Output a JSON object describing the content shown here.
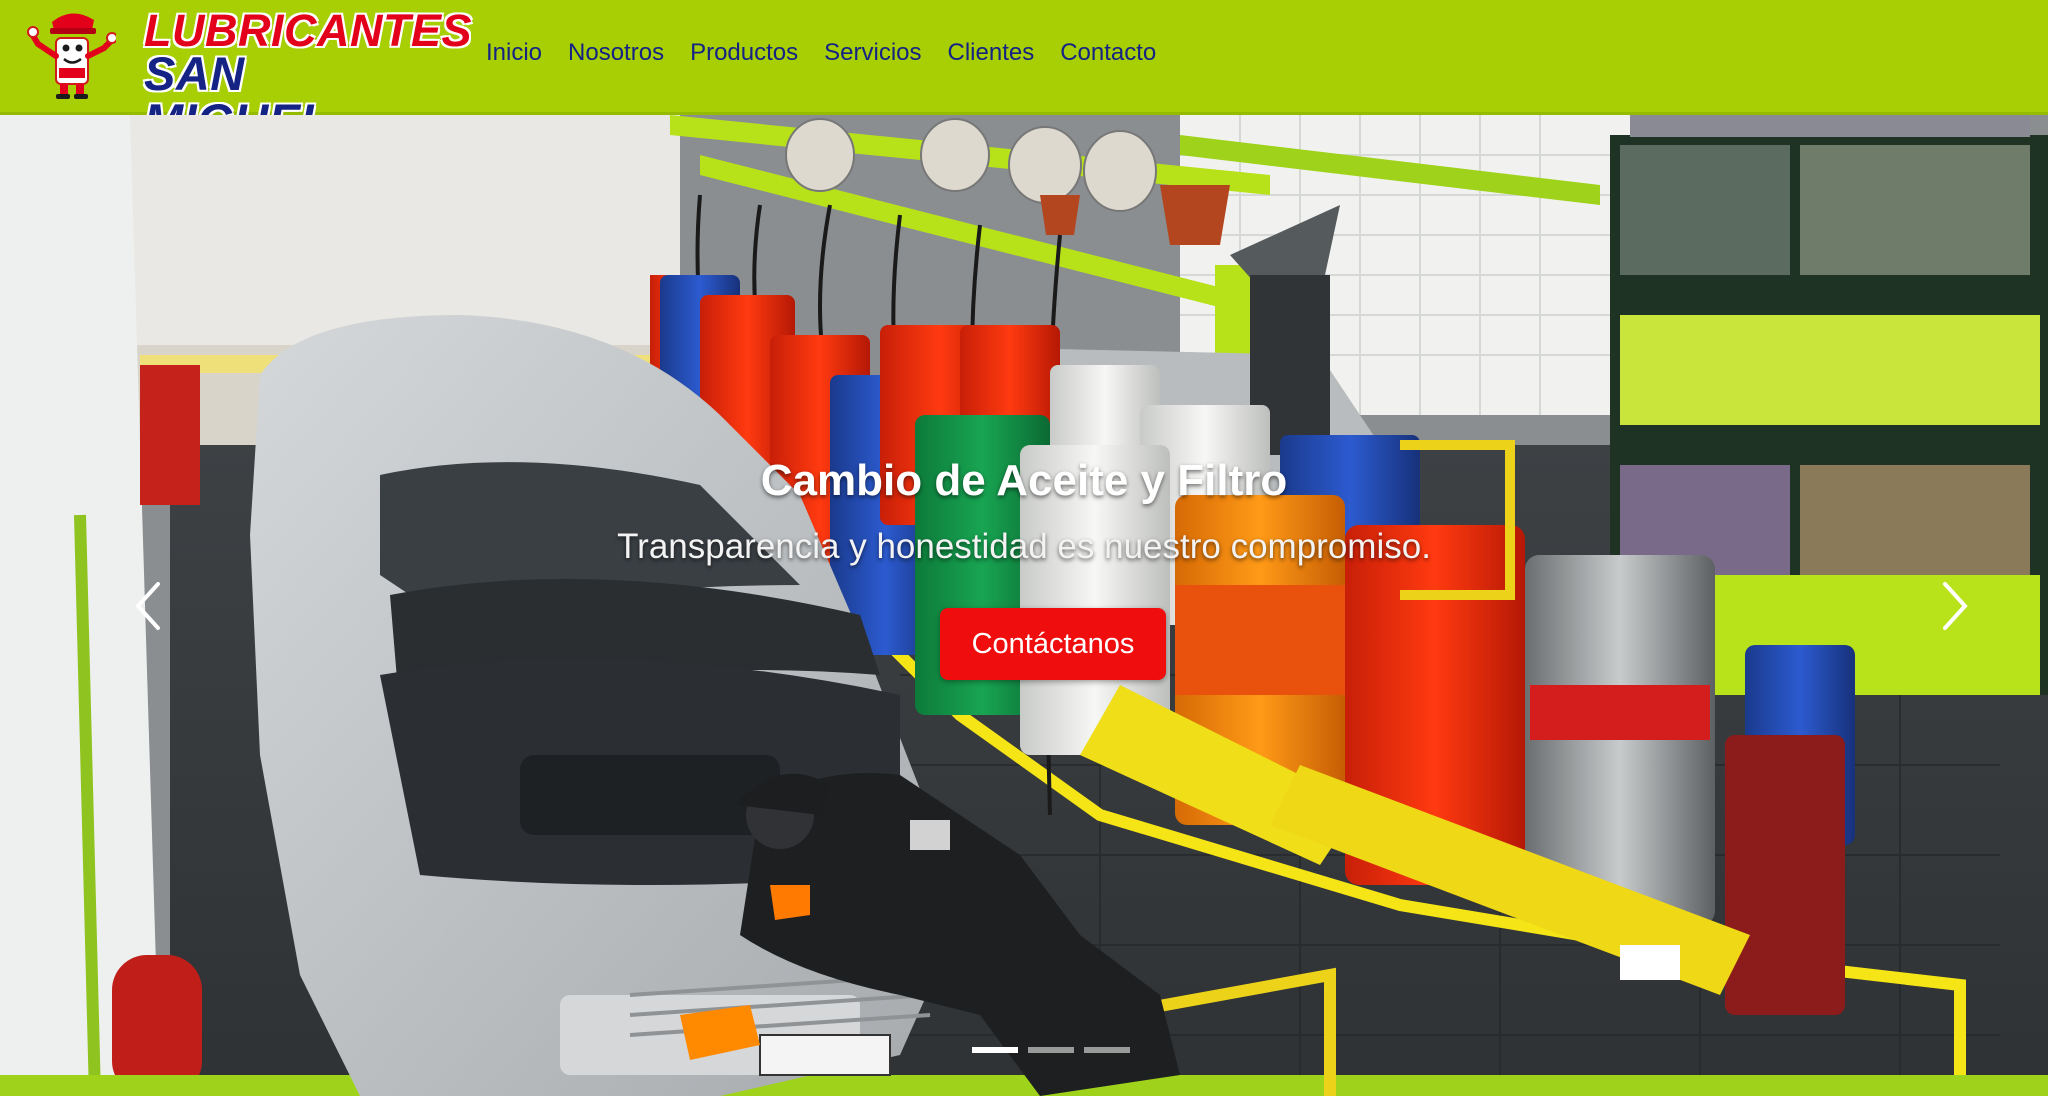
{
  "brand": {
    "line1": "LUBRICANTES",
    "line2": "SAN MIGUEL",
    "mascot_icon": "oil-can-mascot-icon",
    "colors": {
      "nav_bg": "#a7cf03",
      "logo_red": "#e3001b",
      "logo_blue": "#142384"
    }
  },
  "nav": {
    "items": [
      {
        "label": "Inicio"
      },
      {
        "label": "Nosotros"
      },
      {
        "label": "Productos"
      },
      {
        "label": "Servicios"
      },
      {
        "label": "Clientes"
      },
      {
        "label": "Contacto"
      }
    ]
  },
  "carousel": {
    "slide": {
      "title": "Cambio de Aceite y Filtro",
      "subtitle": "Transparencia y honestidad es nuestro compromiso.",
      "button_label": "Contáctanos",
      "image_description_icon": "workshop-photo"
    },
    "prev_icon": "chevron-left-icon",
    "next_icon": "chevron-right-icon",
    "indicators": [
      {
        "active": true
      },
      {
        "active": false
      },
      {
        "active": false
      }
    ],
    "colors": {
      "button": "#f00d0d"
    }
  }
}
